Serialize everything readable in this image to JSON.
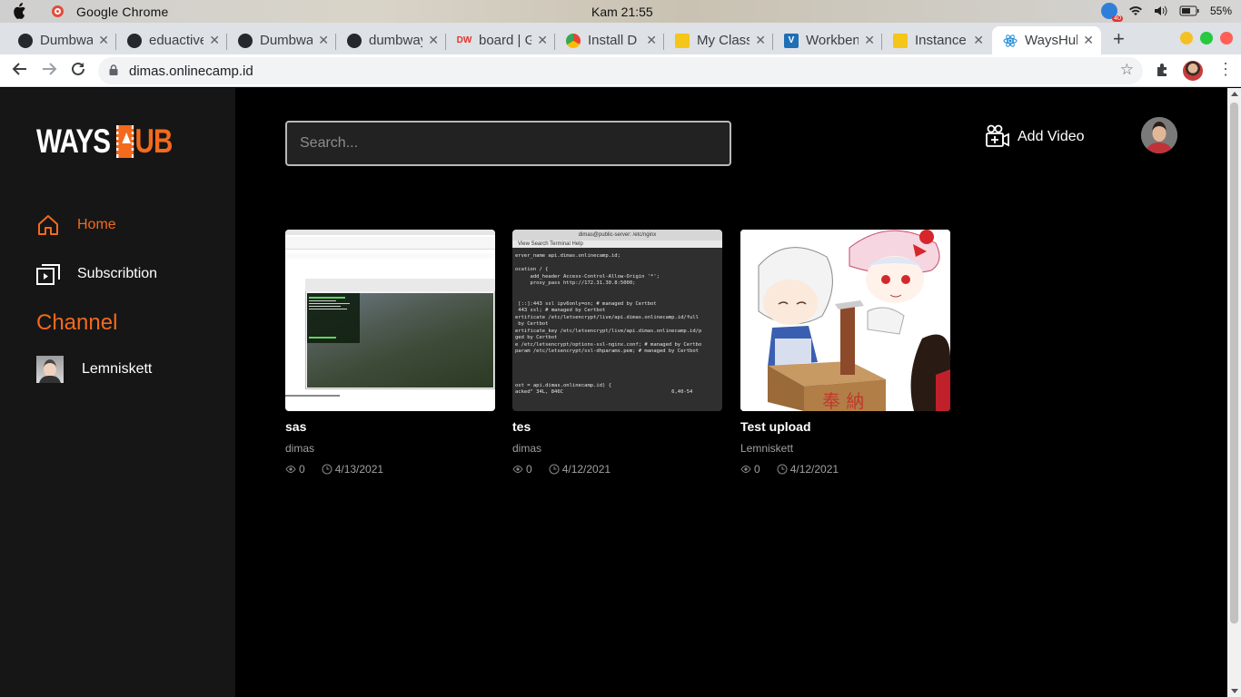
{
  "os": {
    "app_name": "Google Chrome",
    "clock": "Kam 21:55",
    "battery": "55%",
    "notification_count": "40"
  },
  "browser": {
    "tabs": [
      {
        "title": "Dumbways",
        "icon": "github-icon"
      },
      {
        "title": "eduactive",
        "icon": "github-icon"
      },
      {
        "title": "Dumbways",
        "icon": "github-icon"
      },
      {
        "title": "dumbways",
        "icon": "github-icon"
      },
      {
        "title": "board | G",
        "icon": "trello-icon"
      },
      {
        "title": "Install D",
        "icon": "chrome-icon"
      },
      {
        "title": "My Class",
        "icon": "box-icon"
      },
      {
        "title": "Workbench",
        "icon": "v-icon"
      },
      {
        "title": "Instance",
        "icon": "box-icon"
      },
      {
        "title": "WaysHub",
        "icon": "react-icon"
      }
    ],
    "url": "dimas.onlinecamp.id"
  },
  "app": {
    "logo_left": "WAYS",
    "logo_right": "UB",
    "nav": [
      {
        "label": "Home",
        "icon": "home-icon",
        "active": true
      },
      {
        "label": "Subscribtion",
        "icon": "subscription-icon",
        "active": false
      }
    ],
    "channel_heading": "Channel",
    "channels": [
      {
        "name": "Lemniskett"
      }
    ],
    "search_placeholder": "Search...",
    "add_video_label": "Add Video",
    "accent_color": "#f36a1d",
    "videos": [
      {
        "title": "sas",
        "author": "dimas",
        "views": "0",
        "date": "4/13/2021"
      },
      {
        "title": "tes",
        "author": "dimas",
        "views": "0",
        "date": "4/12/2021"
      },
      {
        "title": "Test upload",
        "author": "Lemniskett",
        "views": "0",
        "date": "4/12/2021"
      }
    ]
  },
  "thumbnails": {
    "tes": {
      "window_title": "dimas@public-server: /etc/nginx",
      "menu": "View  Search  Terminal  Help",
      "terminal_text": "erver_name api.dimas.onlinecamp.id;\n\nocation / {\n     add_header Access-Control-Allow-Origin '*';\n     proxy_pass http://172.31.30.8:5000;\n\n\n [::]:443 ssl ipv6only=on; # managed by Certbot\n 443 ssl; # managed by Certbot\nertificate /etc/letsencrypt/live/api.dimas.onlinecamp.id/full\n by Certbot\nertificate_key /etc/letsencrypt/live/api.dimas.onlinecamp.id/p\nged by Certbot\ne /etc/letsencrypt/options-ssl-nginx.conf; # managed by Certbo\nparam /etc/letsencrypt/ssl-dhparams.pem; # managed by Certbot\n\n\n\n\nost = api.dimas.onlinecamp.id) {\nacked\" 34L, 846C                                    6,40-54"
    }
  }
}
